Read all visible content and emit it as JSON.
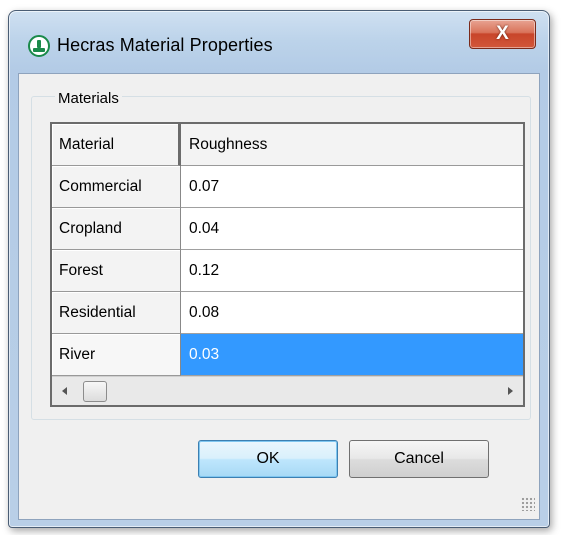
{
  "window": {
    "title": "Hecras Material Properties",
    "close_label": "X"
  },
  "group": {
    "label": "Materials"
  },
  "grid": {
    "columns": [
      "Material",
      "Roughness"
    ],
    "rows": [
      {
        "material": "Commercial",
        "roughness": "0.07"
      },
      {
        "material": "Cropland",
        "roughness": "0.04"
      },
      {
        "material": "Forest",
        "roughness": "0.12"
      },
      {
        "material": "Residential",
        "roughness": "0.08"
      },
      {
        "material": "River",
        "roughness": "0.03"
      }
    ],
    "selected_row": "River"
  },
  "buttons": {
    "ok_label": "OK",
    "cancel_label": "Cancel"
  },
  "colors": {
    "selection": "#3399ff",
    "app_icon": "#1a8a4a",
    "close_button": "#c8452a"
  },
  "icons": {
    "app": "hecras-app-icon",
    "close": "close-icon",
    "scroll_left": "scroll-left-arrow-icon",
    "scroll_right": "scroll-right-arrow-icon",
    "resize": "resize-grip-icon"
  }
}
